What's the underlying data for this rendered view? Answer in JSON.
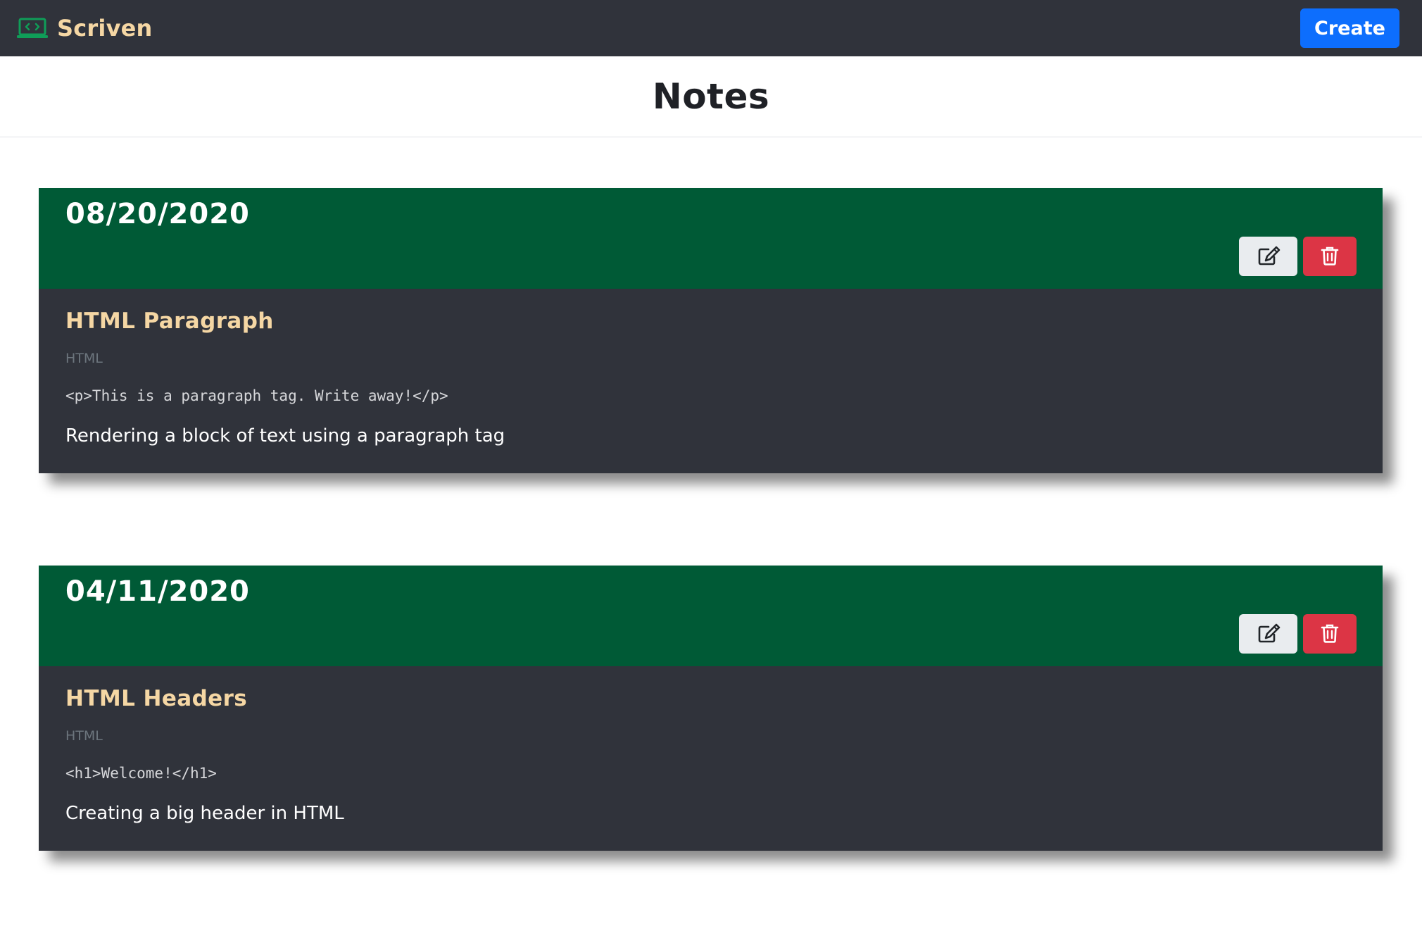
{
  "navbar": {
    "brand": "Scriven",
    "brand_icon": "laptop-code-icon",
    "create_label": "Create",
    "colors": {
      "background": "#30333b",
      "brand_text": "#f5d7a4",
      "create_button": "#0d6efd"
    }
  },
  "page": {
    "title": "Notes"
  },
  "notes": [
    {
      "date": "08/20/2020",
      "title": "HTML Paragraph",
      "language": "HTML",
      "code": "<p>This is a paragraph tag. Write away!</p>",
      "description": "Rendering a block of text using a paragraph tag",
      "edit_icon": "edit-icon",
      "delete_icon": "trash-icon"
    },
    {
      "date": "04/11/2020",
      "title": "HTML Headers",
      "language": "HTML",
      "code": "<h1>Welcome!</h1>",
      "description": "Creating a big header in HTML",
      "edit_icon": "edit-icon",
      "delete_icon": "trash-icon"
    }
  ],
  "colors": {
    "card_header": "#005a36",
    "card_body": "#30333b",
    "note_title": "#f5d7a4",
    "delete_button": "#dc3545",
    "edit_button": "#e9ecef"
  }
}
